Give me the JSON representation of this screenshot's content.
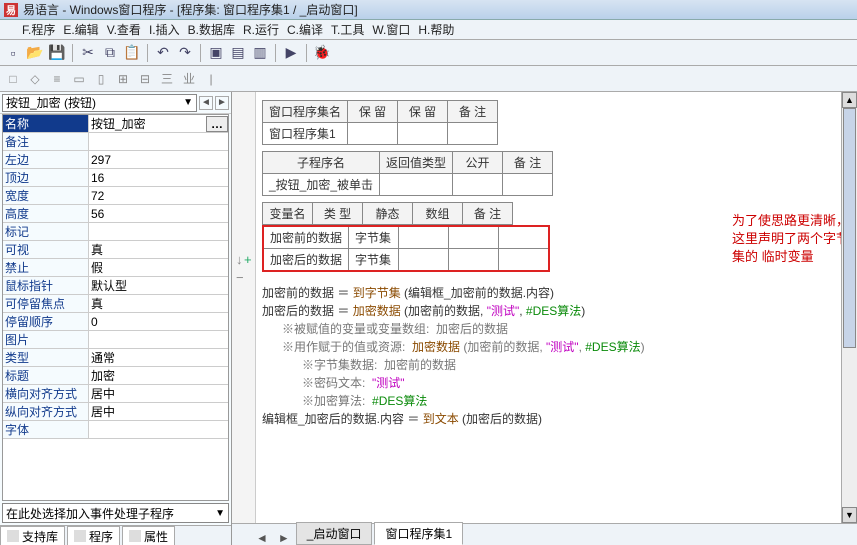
{
  "title": "易语言 - Windows窗口程序 - [程序集: 窗口程序集1 / _启动窗口]",
  "menus": [
    "F.程序",
    "E.编辑",
    "V.查看",
    "I.插入",
    "B.数据库",
    "R.运行",
    "C.编译",
    "T.工具",
    "W.窗口",
    "H.帮助"
  ],
  "toolbar": [
    "new-icon",
    "open-icon",
    "save-icon",
    "sep",
    "cut-icon",
    "copy-icon",
    "paste-icon",
    "sep",
    "undo-icon",
    "redo-icon",
    "sep",
    "layout1-icon",
    "layout2-icon",
    "layout3-icon",
    "sep",
    "run-icon",
    "sep",
    "debug-icon"
  ],
  "toolbar2": [
    "a",
    "b",
    "c",
    "d",
    "e",
    "f",
    "g",
    "h",
    "i",
    "j"
  ],
  "dropdown": "按钮_加密 (按钮)",
  "props": [
    {
      "k": "名称",
      "v": "按钮_加密",
      "header": true,
      "dots": true
    },
    {
      "k": "备注",
      "v": ""
    },
    {
      "k": "左边",
      "v": "297"
    },
    {
      "k": "顶边",
      "v": "16"
    },
    {
      "k": "宽度",
      "v": "72"
    },
    {
      "k": "高度",
      "v": "56"
    },
    {
      "k": "标记",
      "v": ""
    },
    {
      "k": "可视",
      "v": "真"
    },
    {
      "k": "禁止",
      "v": "假"
    },
    {
      "k": "鼠标指针",
      "v": "默认型"
    },
    {
      "k": "可停留焦点",
      "v": "真"
    },
    {
      "k": "停留顺序",
      "v": "0"
    },
    {
      "k": "图片",
      "v": ""
    },
    {
      "k": "类型",
      "v": "通常"
    },
    {
      "k": "标题",
      "v": "加密"
    },
    {
      "k": "横向对齐方式",
      "v": "居中"
    },
    {
      "k": "纵向对齐方式",
      "v": "居中"
    },
    {
      "k": "字体",
      "v": ""
    }
  ],
  "eventbox": "在此处选择加入事件处理子程序",
  "bottomtabs": [
    "支持库",
    "程序",
    "属性"
  ],
  "table1": {
    "headers": [
      "窗口程序集名",
      "保 留",
      "保 留",
      "备 注"
    ],
    "rows": [
      [
        "窗口程序集1",
        "",
        "",
        ""
      ]
    ]
  },
  "table2": {
    "headers": [
      "子程序名",
      "返回值类型",
      "公开",
      "备 注"
    ],
    "rows": [
      [
        "_按钮_加密_被单击",
        "",
        "",
        ""
      ]
    ]
  },
  "table3": {
    "headers": [
      "变量名",
      "类 型",
      "静态",
      "数组",
      "备 注"
    ],
    "rows": [
      [
        "加密前的数据",
        "字节集",
        "",
        "",
        ""
      ],
      [
        "加密后的数据",
        "字节集",
        "",
        "",
        ""
      ]
    ]
  },
  "annotation": "为了使思路更清晰，这里声明了两个字节集的\n临时变量",
  "code": {
    "l1a": "加密前的数据",
    "l1b": " ＝ ",
    "l1c": "到字节集",
    "l1d": " (编辑框_加密前的数据.内容)",
    "l2a": "加密后的数据",
    "l2b": " ＝ ",
    "l2c": "加密数据",
    "l2d": " (加密前的数据, ",
    "l2e": "\"测试\"",
    "l2f": ", ",
    "l2g": "#DES算法",
    "l2h": ")",
    "l3": "※被赋值的变量或变量数组:  加密后的数据",
    "l4a": "※用作赋于的值或资源:  ",
    "l4b": "加密数据",
    "l4c": " (加密前的数据, ",
    "l4d": "\"测试\"",
    "l4e": ", ",
    "l4f": "#DES算法",
    "l4g": ")",
    "l5": "※字节集数据:  加密前的数据",
    "l6a": "※密码文本:  ",
    "l6b": "\"测试\"",
    "l7a": "※加密算法:  ",
    "l7b": "#DES算法",
    "l8a": "编辑框_加密后的数据.内容 ＝ ",
    "l8b": "到文本",
    "l8c": " (加密后的数据)"
  },
  "rtabs": [
    "_启动窗口",
    "窗口程序集1"
  ]
}
